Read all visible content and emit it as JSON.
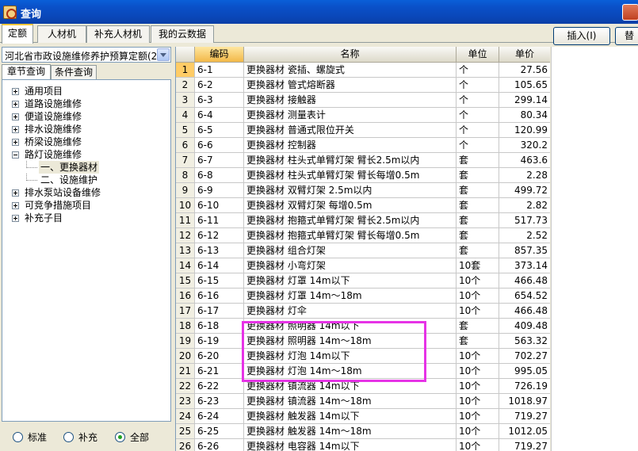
{
  "window": {
    "title": "查询"
  },
  "tabs": [
    {
      "label": "定额",
      "active": true
    },
    {
      "label": "人材机",
      "active": false
    },
    {
      "label": "补充人材机",
      "active": false
    },
    {
      "label": "我的云数据",
      "active": false
    }
  ],
  "toolbar": {
    "insert_label": "插入(I)",
    "replace_label": "替"
  },
  "left": {
    "combo_value": "河北省市政设施维修养护预算定额(2",
    "subtabs": [
      "章节查询",
      "条件查询"
    ],
    "tree": [
      {
        "label": "通用项目",
        "expander": "plus"
      },
      {
        "label": "道路设施维修",
        "expander": "plus"
      },
      {
        "label": "便道设施维修",
        "expander": "plus"
      },
      {
        "label": "排水设施维修",
        "expander": "plus"
      },
      {
        "label": "桥梁设施维修",
        "expander": "plus"
      },
      {
        "label": "路灯设施维修",
        "expander": "minus"
      },
      {
        "label": "一、更换器材",
        "child": true,
        "selected": true
      },
      {
        "label": "二、设施维护",
        "child": true
      },
      {
        "label": "排水泵站设备维修",
        "expander": "plus"
      },
      {
        "label": "可竞争措施项目",
        "expander": "plus"
      },
      {
        "label": "补充子目",
        "expander": "plus"
      }
    ],
    "radios": [
      {
        "label": "标准",
        "checked": false
      },
      {
        "label": "补充",
        "checked": false
      },
      {
        "label": "全部",
        "checked": true
      }
    ]
  },
  "grid": {
    "headers": [
      "",
      "编码",
      "名称",
      "单位",
      "单价"
    ],
    "rows": [
      [
        "1",
        "6-1",
        "更换器材 瓷插、螺旋式",
        "个",
        "27.56"
      ],
      [
        "2",
        "6-2",
        "更换器材 管式熔断器",
        "个",
        "105.65"
      ],
      [
        "3",
        "6-3",
        "更换器材 接触器",
        "个",
        "299.14"
      ],
      [
        "4",
        "6-4",
        "更换器材 测量表计",
        "个",
        "80.34"
      ],
      [
        "5",
        "6-5",
        "更换器材 普通式限位开关",
        "个",
        "120.99"
      ],
      [
        "6",
        "6-6",
        "更换器材 控制器",
        "个",
        "320.2"
      ],
      [
        "7",
        "6-7",
        "更换器材 柱头式单臂灯架 臂长2.5m以内",
        "套",
        "463.6"
      ],
      [
        "8",
        "6-8",
        "更换器材 柱头式单臂灯架 臂长每增0.5m",
        "套",
        "2.28"
      ],
      [
        "9",
        "6-9",
        "更换器材 双臂灯架 2.5m以内",
        "套",
        "499.72"
      ],
      [
        "10",
        "6-10",
        "更换器材 双臂灯架 每增0.5m",
        "套",
        "2.82"
      ],
      [
        "11",
        "6-11",
        "更换器材 抱箍式单臂灯架 臂长2.5m以内",
        "套",
        "517.73"
      ],
      [
        "12",
        "6-12",
        "更换器材 抱箍式单臂灯架 臂长每增0.5m",
        "套",
        "2.52"
      ],
      [
        "13",
        "6-13",
        "更换器材 组合灯架",
        "套",
        "857.35"
      ],
      [
        "14",
        "6-14",
        "更换器材 小弯灯架",
        "10套",
        "373.14"
      ],
      [
        "15",
        "6-15",
        "更换器材 灯罩 14m以下",
        "10个",
        "466.48"
      ],
      [
        "16",
        "6-16",
        "更换器材 灯罩 14m～18m",
        "10个",
        "654.52"
      ],
      [
        "17",
        "6-17",
        "更换器材 灯伞",
        "10个",
        "466.48"
      ],
      [
        "18",
        "6-18",
        "更换器材 照明器 14m以下",
        "套",
        "409.48"
      ],
      [
        "19",
        "6-19",
        "更换器材 照明器 14m～18m",
        "套",
        "563.32"
      ],
      [
        "20",
        "6-20",
        "更换器材 灯泡 14m以下",
        "10个",
        "702.27"
      ],
      [
        "21",
        "6-21",
        "更换器材 灯泡 14m～18m",
        "10个",
        "995.05"
      ],
      [
        "22",
        "6-22",
        "更换器材 镇流器 14m以下",
        "10个",
        "726.19"
      ],
      [
        "23",
        "6-23",
        "更换器材 镇流器 14m～18m",
        "10个",
        "1018.97"
      ],
      [
        "24",
        "6-24",
        "更换器材 触发器 14m以下",
        "10个",
        "719.27"
      ],
      [
        "25",
        "6-25",
        "更换器材 触发器 14m～18m",
        "10个",
        "1012.05"
      ],
      [
        "26",
        "6-26",
        "更换器材 电容器 14m以下",
        "10个",
        "719.27"
      ]
    ]
  },
  "colors": {
    "highlight": "#e633e6",
    "title_bar": "#0a50c8",
    "active_tab_accent": "#ffc83c"
  }
}
